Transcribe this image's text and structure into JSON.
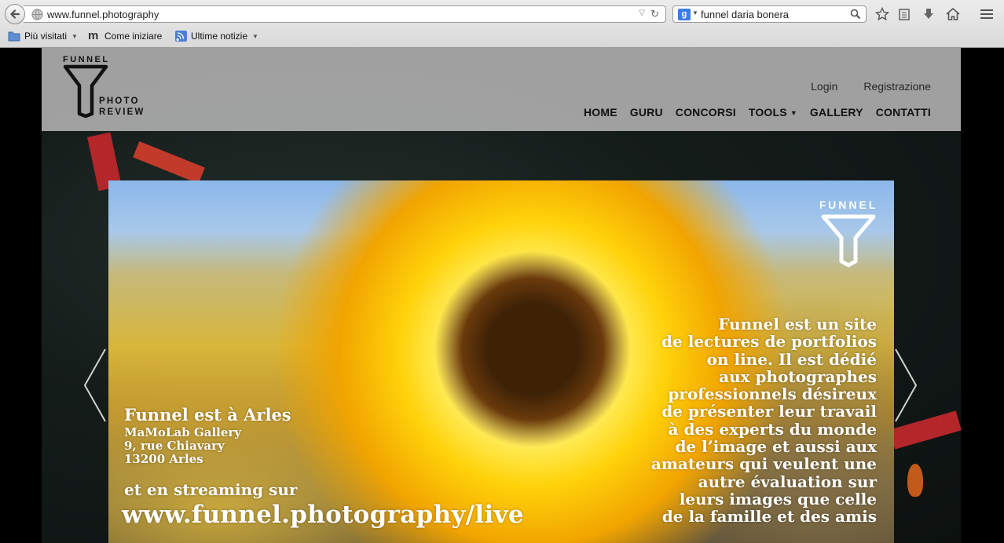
{
  "browser": {
    "url": "www.funnel.photography",
    "search_query": "funnel daria bonera",
    "search_engine_icon": "g",
    "bookmarks": [
      {
        "label": "Più visitati",
        "icon": "folder-icon",
        "dropdown": true
      },
      {
        "label": "Come iniziare",
        "icon": "m-icon",
        "dropdown": false
      },
      {
        "label": "Ultime notizie",
        "icon": "rss-icon",
        "dropdown": true
      }
    ]
  },
  "site": {
    "logo": {
      "top": "FUNNEL",
      "line1": "PHOTO",
      "line2": "REVIEW"
    },
    "account_links": [
      "Login",
      "Registrazione"
    ],
    "nav": [
      {
        "label": "HOME",
        "dropdown": false
      },
      {
        "label": "GURU",
        "dropdown": false
      },
      {
        "label": "CONCORSI",
        "dropdown": false
      },
      {
        "label": "TOOLS",
        "dropdown": true
      },
      {
        "label": "GALLERY",
        "dropdown": false
      },
      {
        "label": "CONTATTI",
        "dropdown": false
      }
    ]
  },
  "slide": {
    "watermark": "FUNNEL",
    "heading": "Funnel est à Arles",
    "address": [
      "MaMoLab Gallery",
      "9, rue Chiavary",
      "13200 Arles"
    ],
    "streaming": "et en streaming sur",
    "stream_url": "www.funnel.photography/live",
    "description_lines": [
      "Funnel est un site",
      "de lectures de portfolios",
      "on line. Il est dédié",
      "aux photographes",
      "professionnels désireux",
      "de présenter leur travail",
      "à des experts du monde",
      "de l’image et aussi aux",
      "amateurs qui veulent une",
      "autre évaluation sur",
      "leurs images que celle",
      "de la famille et des amis"
    ]
  },
  "colors": {
    "header_bg": "#a5a5a5",
    "sunflower_yellow": "#ffd20a"
  }
}
